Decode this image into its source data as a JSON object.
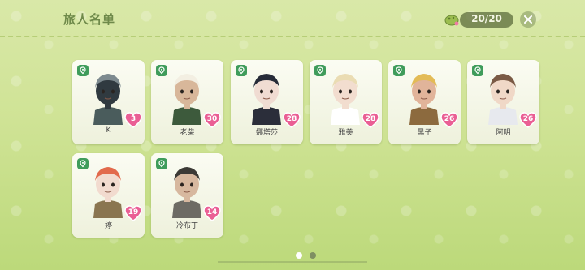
{
  "header": {
    "title": "旅人名单",
    "count": "20/20",
    "coin_icon": "mushroom-coin-icon",
    "close_icon": "close-icon"
  },
  "colors": {
    "heart": "#ea5f94",
    "badge": "#3f9c5b",
    "text": "#444444"
  },
  "travelers": [
    {
      "name": "K",
      "level": "3",
      "hair": "#7d8a8f",
      "skin": "#303a40",
      "outfit": "#4a5c5c"
    },
    {
      "name": "老柴",
      "level": "30",
      "hair": "#f3efe2",
      "skin": "#d8b79a",
      "outfit": "#3d5a3c"
    },
    {
      "name": "娜塔莎",
      "level": "28",
      "hair": "#262b38",
      "skin": "#f0dcd2",
      "outfit": "#2b2e3a"
    },
    {
      "name": "雅美",
      "level": "28",
      "hair": "#eadcb3",
      "skin": "#f2ddcf",
      "outfit": "#ffffff"
    },
    {
      "name": "黑子",
      "level": "26",
      "hair": "#e3bb56",
      "skin": "#e1b49a",
      "outfit": "#8c6a3e"
    },
    {
      "name": "阿明",
      "level": "26",
      "hair": "#7a5a45",
      "skin": "#f0d8c7",
      "outfit": "#e7e9ee"
    },
    {
      "name": "婷",
      "level": "19",
      "hair": "#e26a4c",
      "skin": "#f2dbcf",
      "outfit": "#8a7550"
    },
    {
      "name": "冷布丁",
      "level": "14",
      "hair": "#3c3a36",
      "skin": "#d7b89f",
      "outfit": "#6d6b64"
    }
  ],
  "pagination": {
    "pages": 2,
    "current": 1
  }
}
